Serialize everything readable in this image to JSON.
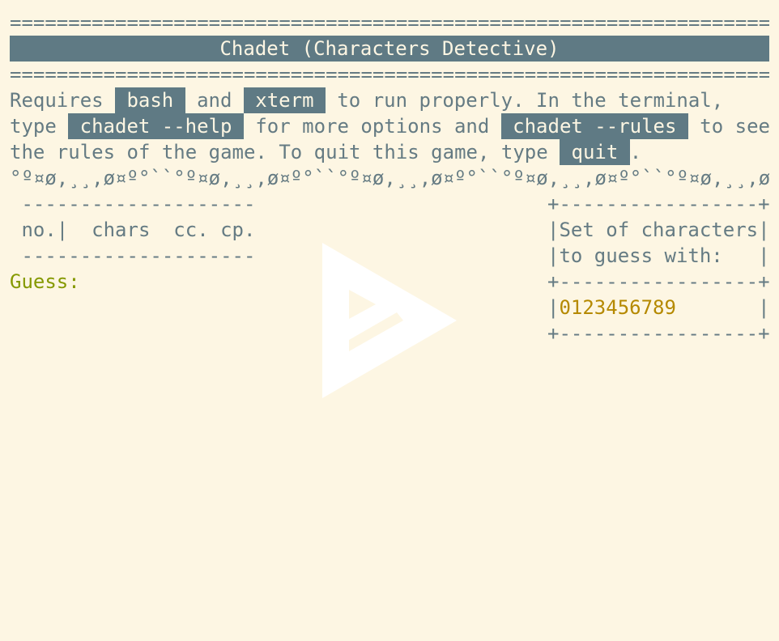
{
  "rule_line": "====================================================================",
  "title": "Chadet (Characters Detective)",
  "intro": {
    "line1_pre": "Requires ",
    "cmd_bash": "bash",
    "line1_mid": " and ",
    "cmd_xterm": "xterm",
    "line1_post": " to run properly. In the terminal,",
    "line2_pre": "type ",
    "cmd_help": "chadet --help",
    "line2_mid": " for more options and ",
    "cmd_rules": "chadet --rules",
    "line2_post": " to see",
    "line3_pre": "the rules of the game. To quit this game, type ",
    "cmd_quit": "quit",
    "line3_post": "."
  },
  "decor_line": "°º¤ø,¸¸,ø¤º°``°º¤ø,¸¸,ø¤º°``°º¤ø,¸¸,ø¤º°``°º¤ø,¸¸,ø¤º°``°º¤ø,¸¸,ø¤°",
  "table": {
    "separator": " --------------------",
    "header": " no.|  chars  cc. cp."
  },
  "guess_prompt": "Guess:",
  "charset_box": {
    "border": "+-----------------+",
    "line1": "|Set of characters|",
    "line2": "|to guess with:   |",
    "left_bar": "|",
    "digits": "0123456789",
    "right_pad": "       |"
  },
  "colors": {
    "background": "#fdf6e3",
    "text": "#657b83",
    "highlight_bg": "#5f7a84",
    "guess": "#859900",
    "digits": "#b58900"
  },
  "overlay_icon": "play-logo-icon"
}
